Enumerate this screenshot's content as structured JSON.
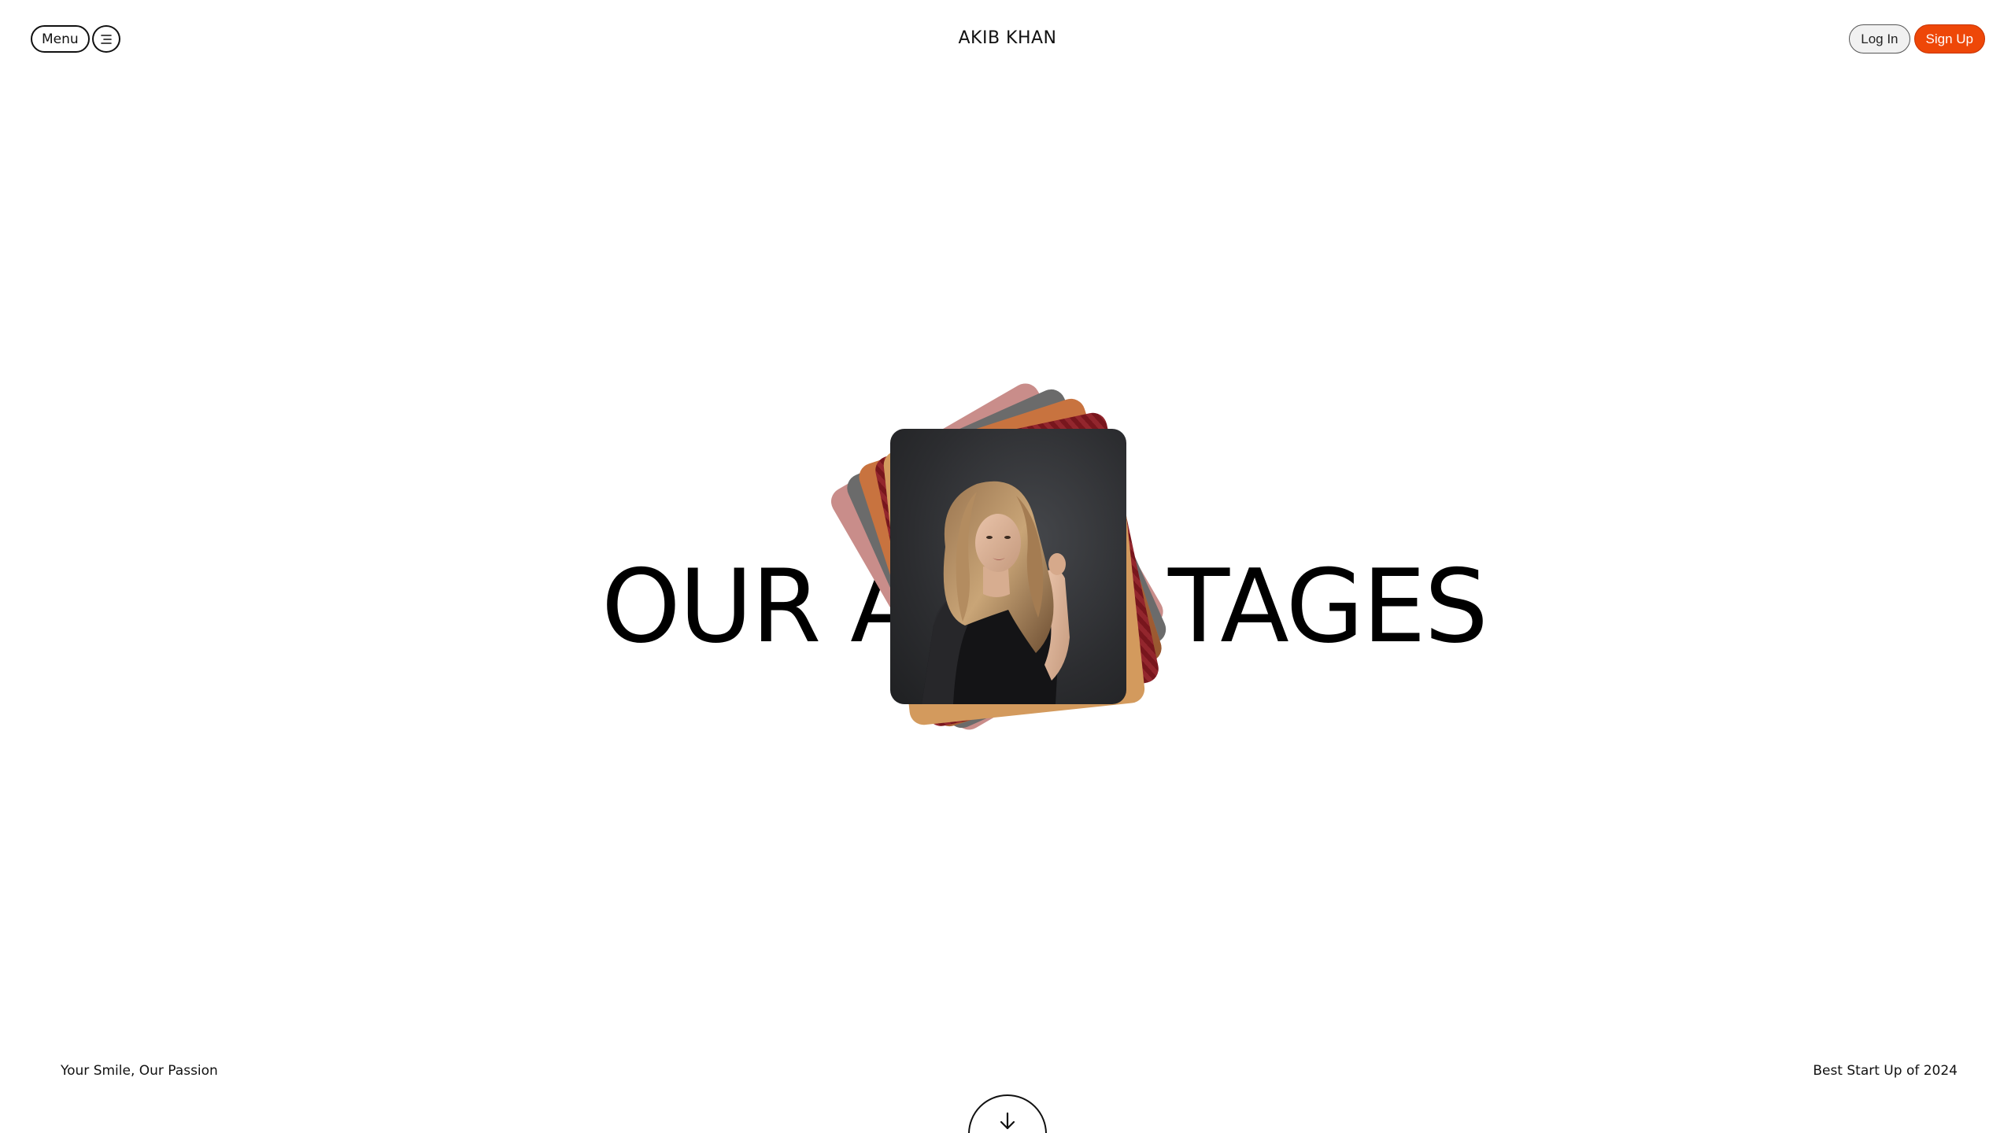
{
  "header": {
    "menu_label": "Menu",
    "menu_icon": "hamburger-menu-icon",
    "site_title": "AKIB KHAN",
    "login_label": "Log In",
    "signup_label": "Sign Up"
  },
  "hero": {
    "title_left": "OUR A",
    "title_right": "TAGES",
    "cards": [
      {
        "icon": "dusty-pink-photo"
      },
      {
        "icon": "grey-photo"
      },
      {
        "icon": "tan-photo"
      },
      {
        "icon": "red-fabric-photo"
      },
      {
        "icon": "beige-photo"
      }
    ],
    "main_photo_icon": "woman-portrait-photo"
  },
  "footer": {
    "left_text": "Your Smile, Our Passion",
    "right_text": "Best Start Up of 2024",
    "scroll_icon": "arrow-down-icon"
  },
  "colors": {
    "accent": "#ee4708",
    "text": "#111111",
    "background": "#ffffff"
  }
}
